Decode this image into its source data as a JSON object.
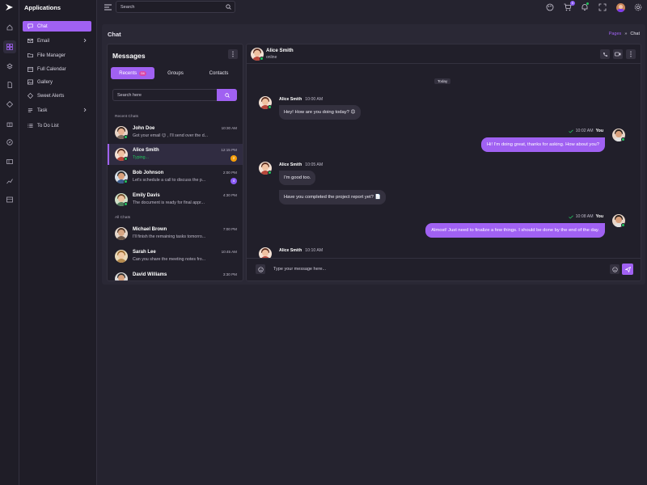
{
  "sidebar": {
    "title": "Applications",
    "items": [
      {
        "label": "Chat",
        "icon": "chat-icon"
      },
      {
        "label": "Email",
        "icon": "mail-icon"
      },
      {
        "label": "File Manager",
        "icon": "folder-icon"
      },
      {
        "label": "Full Calendar",
        "icon": "calendar-icon"
      },
      {
        "label": "Gallery",
        "icon": "image-icon"
      },
      {
        "label": "Sweet Alerts",
        "icon": "alert-icon"
      },
      {
        "label": "Task",
        "icon": "task-icon"
      },
      {
        "label": "To Do List",
        "icon": "list-icon"
      }
    ]
  },
  "topbar": {
    "search_placeholder": "Search",
    "cart_count": "5"
  },
  "page": {
    "title": "Chat",
    "breadcrumb": {
      "parent": "Pages",
      "separator": "»",
      "current": "Chat"
    }
  },
  "messages_panel": {
    "title": "Messages",
    "tabs": [
      {
        "label": "Recents",
        "badge": "04"
      },
      {
        "label": "Groups"
      },
      {
        "label": "Contacts"
      }
    ],
    "search_placeholder": "Search here",
    "recent_label": "Recent Chats",
    "all_label": "All Chats",
    "recent_chats": [
      {
        "name": "John Doe",
        "preview": "Got your email 😊 , I'll send over the d...",
        "time": "10:30 AM"
      },
      {
        "name": "Alice Smith",
        "preview": "Typing...",
        "time": "12:15 PM",
        "badge": "2"
      },
      {
        "name": "Bob Johnson",
        "preview": "Let's schedule a call to discuss the p...",
        "time": "2:00 PM",
        "badge": "4"
      },
      {
        "name": "Emily Davis",
        "preview": "The document is ready for final appr...",
        "time": "4:30 PM"
      }
    ],
    "all_chats": [
      {
        "name": "Michael Brown",
        "preview": "I'll finish the remaining tasks tomorro...",
        "time": "7:00 PM"
      },
      {
        "name": "Sarah Lee",
        "preview": "Can you share the meeting notes fro...",
        "time": "10:45 AM"
      },
      {
        "name": "David Williams",
        "preview": "",
        "time": "3:30 PM"
      }
    ]
  },
  "conversation": {
    "contact_name": "Alice Smith",
    "contact_status": "online",
    "date_divider": "Today",
    "messages": [
      {
        "sender": "Alice Smith",
        "time": "10:00 AM",
        "texts": [
          "Hey! How are you doing today? 😊"
        ]
      },
      {
        "sender": "You",
        "time": "10:02 AM",
        "texts": [
          "Hi! I'm doing great, thanks for asking. How about you?"
        ]
      },
      {
        "sender": "Alice Smith",
        "time": "10:05 AM",
        "texts": [
          "I'm good too.",
          "Have you completed the project report yet? 📄"
        ]
      },
      {
        "sender": "You",
        "time": "10:08 AM",
        "texts": [
          "Almost! Just need to finalize a few things. I should be done by the end of the day."
        ]
      },
      {
        "sender": "Alice Smith",
        "time": "10:10 AM",
        "texts": []
      }
    ],
    "composer_placeholder": "Type your message here..."
  },
  "colors": {
    "accent": "#a061f2",
    "background": "#25232f",
    "panel": "#211f2a",
    "online": "#22c55e",
    "badge_orange": "#f59e0b",
    "badge_purple": "#8b5cf6"
  }
}
